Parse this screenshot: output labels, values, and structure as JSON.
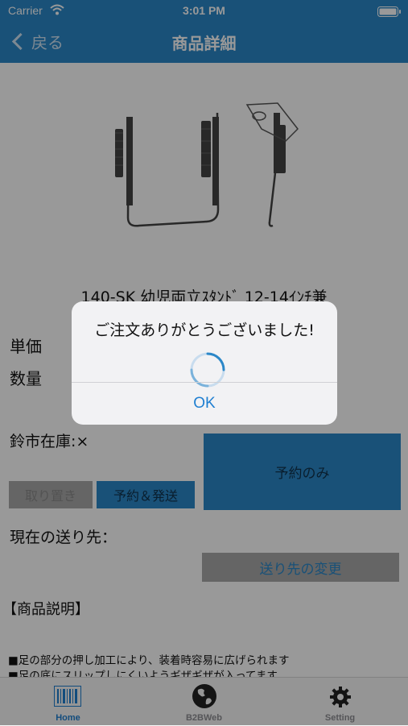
{
  "status_bar": {
    "carrier": "Carrier",
    "time": "3:01 PM"
  },
  "nav": {
    "back_label": "戻る",
    "title": "商品詳細"
  },
  "product": {
    "name": "140-SK 幼児両立ｽﾀﾝﾄﾞ 12-14ｲﾝﾁ兼",
    "unit_price_label": "単価",
    "quantity_label": "数量",
    "stock_text": "鈴市在庫:×",
    "reserve_only_label": "予約のみ",
    "cancel_label": "取り置き",
    "reserve_ship_label": "予約＆発送",
    "current_dest_label": "現在の送り先：",
    "change_dest_label": "送り先の変更",
    "description_header": "【商品説明】",
    "description_lines": [
      "■足の部分の押し加工により、装着時容易に広げられます",
      "■足の底にスリップしにくいようギザギザが入ってます"
    ]
  },
  "alert": {
    "message": "ご注文ありがとうございました!",
    "ok_label": "OK"
  },
  "tabs": [
    {
      "label": "Home",
      "icon": "barcode-icon"
    },
    {
      "label": "B2BWeb",
      "icon": "globe-icon"
    },
    {
      "label": "Setting",
      "icon": "gear-icon"
    }
  ],
  "colors": {
    "accent": "#2b87c8",
    "tab_active": "#1f7fd1",
    "tab_inactive": "#8e8e93",
    "button_gray": "#a8a8a8"
  }
}
